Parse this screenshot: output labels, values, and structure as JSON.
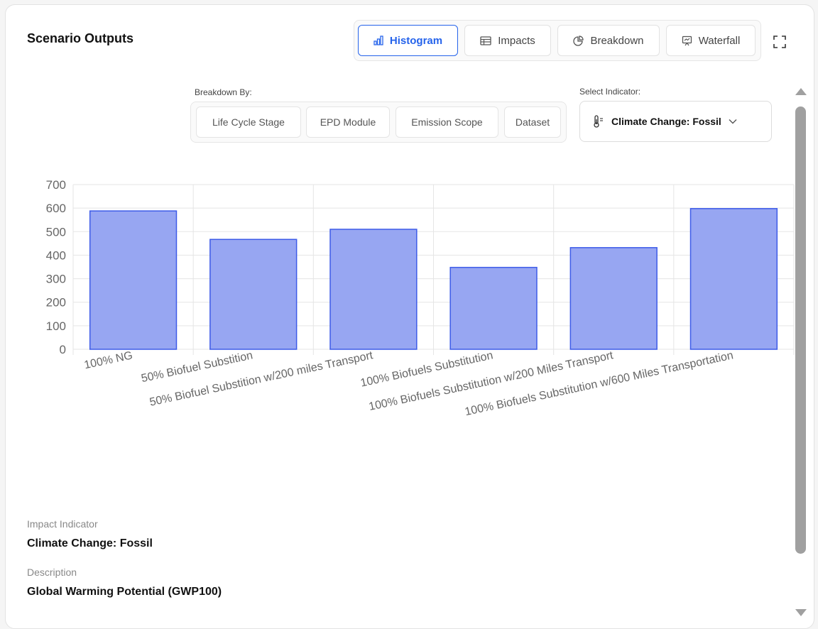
{
  "panel": {
    "title": "Scenario Outputs",
    "expand_icon": "expand-icon"
  },
  "view_tabs": [
    {
      "label": "Histogram",
      "icon": "bar-chart-icon",
      "active": true
    },
    {
      "label": "Impacts",
      "icon": "table-icon",
      "active": false
    },
    {
      "label": "Breakdown",
      "icon": "pie-chart-icon",
      "active": false
    },
    {
      "label": "Waterfall",
      "icon": "presentation-icon",
      "active": false
    }
  ],
  "breakdown": {
    "label": "Breakdown By:",
    "options": [
      "Life Cycle Stage",
      "EPD Module",
      "Emission Scope",
      "Dataset"
    ]
  },
  "indicator": {
    "label": "Select Indicator:",
    "selected": "Climate Change: Fossil",
    "icon": "thermometer-icon"
  },
  "colors": {
    "accent": "#2563eb",
    "bar_fill": "#97a6f2",
    "bar_stroke": "#3d5be8",
    "grid": "#e5e5e5"
  },
  "chart_data": {
    "type": "bar",
    "categories": [
      "100% NG",
      "50% Biofuel Substition",
      "50% Biofuel Substition w/200 miles Transport",
      "100% Biofuels Substitution",
      "100% Biofuels Substitution w/200 Miles Transport",
      "100% Biofuels Substitution w/600 Miles Transportation"
    ],
    "values": [
      588,
      467,
      510,
      348,
      432,
      598
    ],
    "ylim": [
      0,
      700
    ],
    "yticks": [
      0,
      100,
      200,
      300,
      400,
      500,
      600,
      700
    ],
    "grid": true,
    "legend": "none"
  },
  "details": {
    "impact_label": "Impact Indicator",
    "impact_value": "Climate Change: Fossil",
    "description_label": "Description",
    "description_value": "Global Warming Potential (GWP100)"
  }
}
